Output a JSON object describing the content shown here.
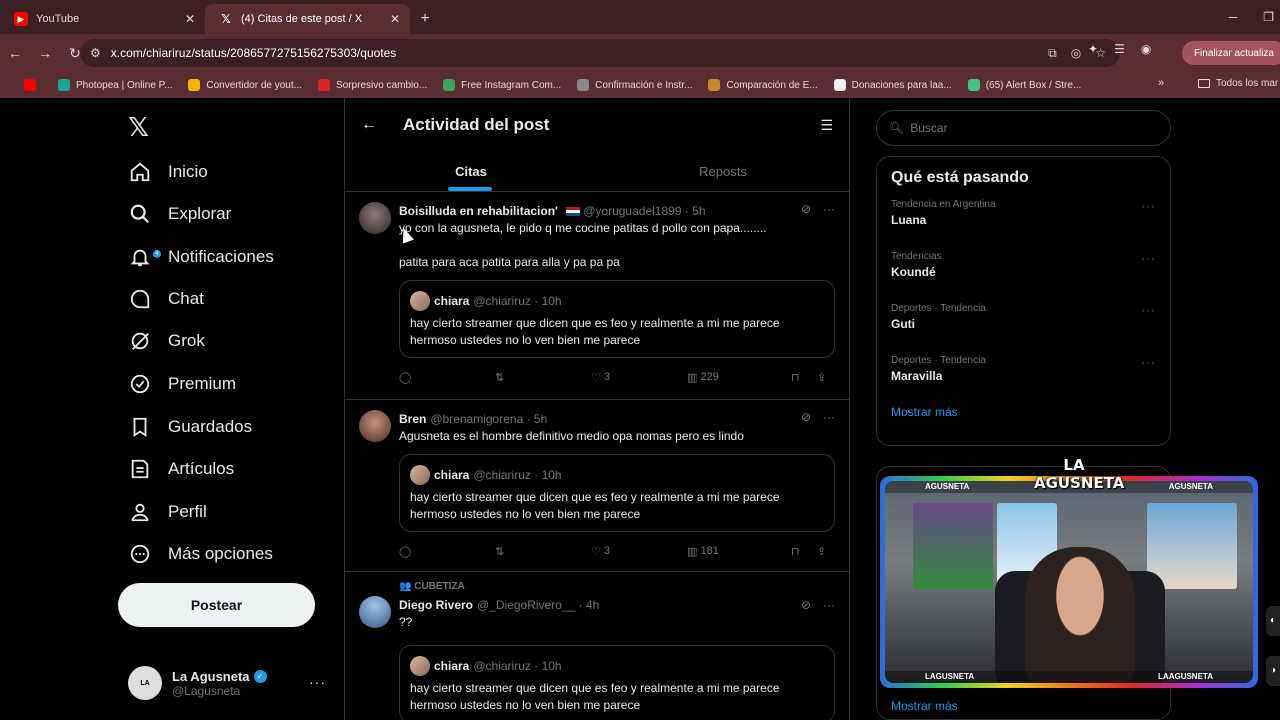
{
  "browser": {
    "tabs": [
      {
        "title": "YouTube",
        "icon": "youtube-icon",
        "active": false
      },
      {
        "title": "(4) Citas de este post / X",
        "icon": "x-icon",
        "active": true
      }
    ],
    "url": "x.com/chiariruz/status/2086577275156275303/quotes",
    "update_label": "Finalizar actualiza",
    "bookmarks": [
      {
        "label": "Photopea | Online P...",
        "color": "#18a497"
      },
      {
        "label": "Convertidor de yout...",
        "color": "#f5b400"
      },
      {
        "label": "Sorpresivo cambio...",
        "color": "#d22"
      },
      {
        "label": "Free Instagram Com...",
        "color": "#3aa757"
      },
      {
        "label": "Confirmación e Instr...",
        "color": "#888"
      },
      {
        "label": "Comparación de E...",
        "color": "#c48a2a"
      },
      {
        "label": "Donaciones para laa...",
        "color": "#eee"
      },
      {
        "label": "(65) Alert Box / Stre...",
        "color": "#3fc27d"
      }
    ],
    "all_bookmarks": "Todos los mar"
  },
  "sidebar": {
    "items": [
      {
        "label": "Inicio",
        "icon": "home-icon"
      },
      {
        "label": "Explorar",
        "icon": "search-icon"
      },
      {
        "label": "Notificaciones",
        "icon": "bell-icon",
        "badge": "4"
      },
      {
        "label": "Chat",
        "icon": "chat-icon"
      },
      {
        "label": "Grok",
        "icon": "grok-icon"
      },
      {
        "label": "Premium",
        "icon": "premium-icon"
      },
      {
        "label": "Guardados",
        "icon": "bookmark-icon"
      },
      {
        "label": "Artículos",
        "icon": "articles-icon"
      },
      {
        "label": "Perfil",
        "icon": "profile-icon"
      },
      {
        "label": "Más opciones",
        "icon": "more-options-icon"
      }
    ],
    "post_button": "Postear",
    "account": {
      "name": "La Agusneta",
      "handle": "@Lagusneta"
    }
  },
  "main": {
    "title": "Actividad del post",
    "tabs": [
      "Citas",
      "Reposts"
    ],
    "posts": [
      {
        "name": "Boisilluda en rehabilitacion'",
        "handle": "@yoruguadel1899",
        "time": "· 5h",
        "text": "yo con la agusneta, le pido q me cocine patitas d pollo con papa........",
        "text2": "patita para aca patita para alla y pa pa pa",
        "likes": "3",
        "views": "229"
      },
      {
        "name": "Bren",
        "handle": "@brenamigorena",
        "time": "· 5h",
        "text": "Agusneta es el hombre definitivo medio opa nomas pero es lindo",
        "likes": "3",
        "views": "181"
      },
      {
        "social": "CUBETIZA",
        "name": "Diego Rivero",
        "handle": "@_DiegoRivero__",
        "time": "· 4h",
        "text": "??"
      }
    ],
    "quote": {
      "name": "chiara",
      "handle": "@chiariruz",
      "time": "· 10h",
      "text": "hay cierto streamer que dicen que es feo y realmente a mi me parece hermoso ustedes no lo ven bien me parece"
    }
  },
  "right": {
    "search_placeholder": "Buscar",
    "trends_title": "Qué está pasando",
    "trends": [
      {
        "context": "Tendencia en Argentina",
        "name": "Luana"
      },
      {
        "context": "Tendencias",
        "name": "Koundé"
      },
      {
        "context": "Deportes · Tendencia",
        "name": "Guti"
      },
      {
        "context": "Deportes · Tendencia",
        "name": "Maravilla"
      }
    ],
    "show_more": "Mostrar más",
    "show_more_2": "Mostrar más"
  },
  "overlay": {
    "logo": "LA AGUSNETA",
    "top_left": "AGUSNETA",
    "top_right": "AGUSNETA",
    "bottom_left": "LAGUSNETA",
    "bottom_right": "LAAGUSNETA"
  }
}
